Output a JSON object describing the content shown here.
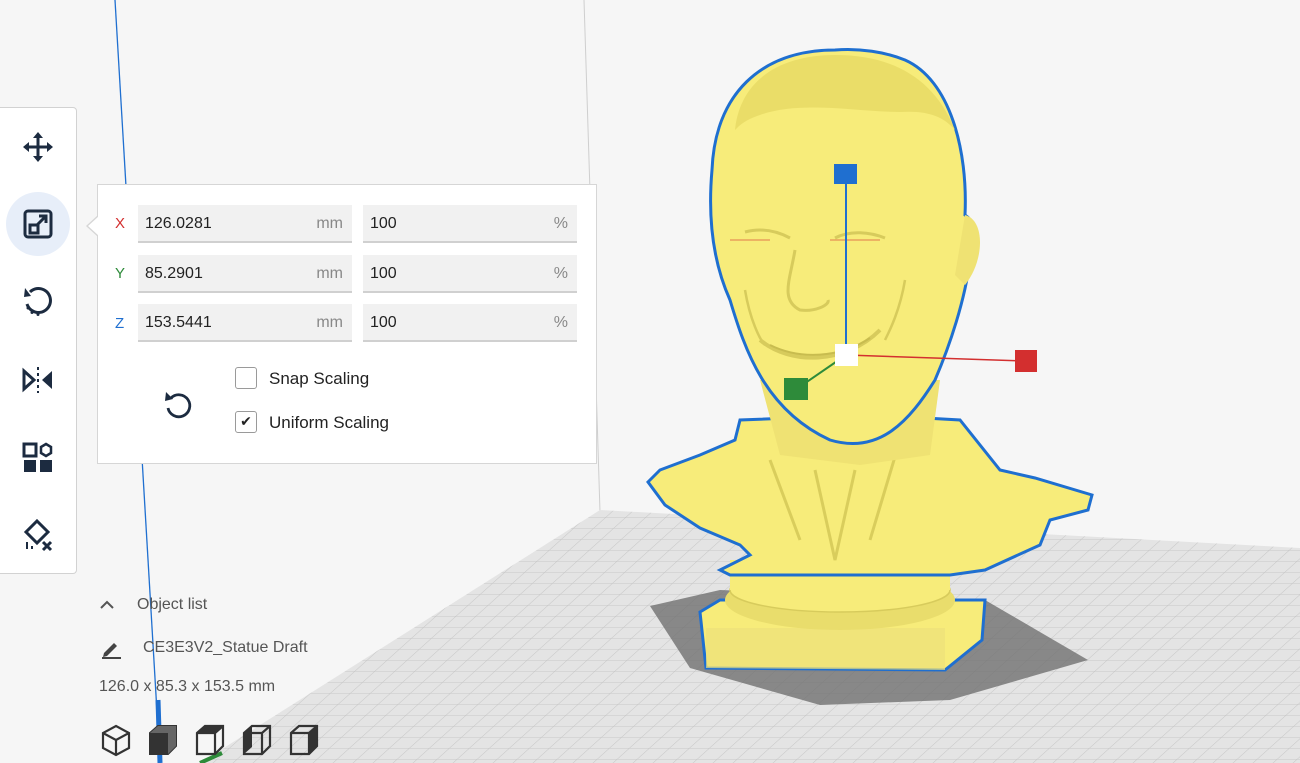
{
  "scale_panel": {
    "rows": [
      {
        "axis": "X",
        "axis_color": "#d32f2f",
        "mm_value": "126.0281",
        "mm_unit": "mm",
        "percent_value": "100",
        "percent_unit": "%"
      },
      {
        "axis": "Y",
        "axis_color": "#2e8b3a",
        "mm_value": "85.2901",
        "mm_unit": "mm",
        "percent_value": "100",
        "percent_unit": "%"
      },
      {
        "axis": "Z",
        "axis_color": "#1f6fd0",
        "mm_value": "153.5441",
        "mm_unit": "mm",
        "percent_value": "100",
        "percent_unit": "%"
      }
    ],
    "snap_scaling": {
      "label": "Snap Scaling",
      "checked": false
    },
    "uniform_scaling": {
      "label": "Uniform Scaling",
      "checked": true,
      "check_glyph": "✔"
    }
  },
  "toolbar": {
    "tools": [
      {
        "name": "move-icon",
        "active": false
      },
      {
        "name": "scale-icon",
        "active": true
      },
      {
        "name": "rotate-icon",
        "active": false
      },
      {
        "name": "mirror-icon",
        "active": false
      },
      {
        "name": "per-model-settings-icon",
        "active": false
      },
      {
        "name": "support-blocker-icon",
        "active": false
      }
    ]
  },
  "object_list": {
    "title": "Object list",
    "object_name": "CE3E3V2_Statue Draft",
    "dimensions": "126.0 x 85.3 x 153.5 mm"
  },
  "view_buttons": [
    "3d-view-icon",
    "front-view-icon",
    "top-view-icon",
    "left-view-icon",
    "right-view-icon"
  ],
  "colors": {
    "model": "#f7ec7a",
    "model_outline": "#1f6fd0",
    "accent": "#1f6fd0",
    "build_plate": "#e4e4e4",
    "grid": "#c4c4c4"
  }
}
